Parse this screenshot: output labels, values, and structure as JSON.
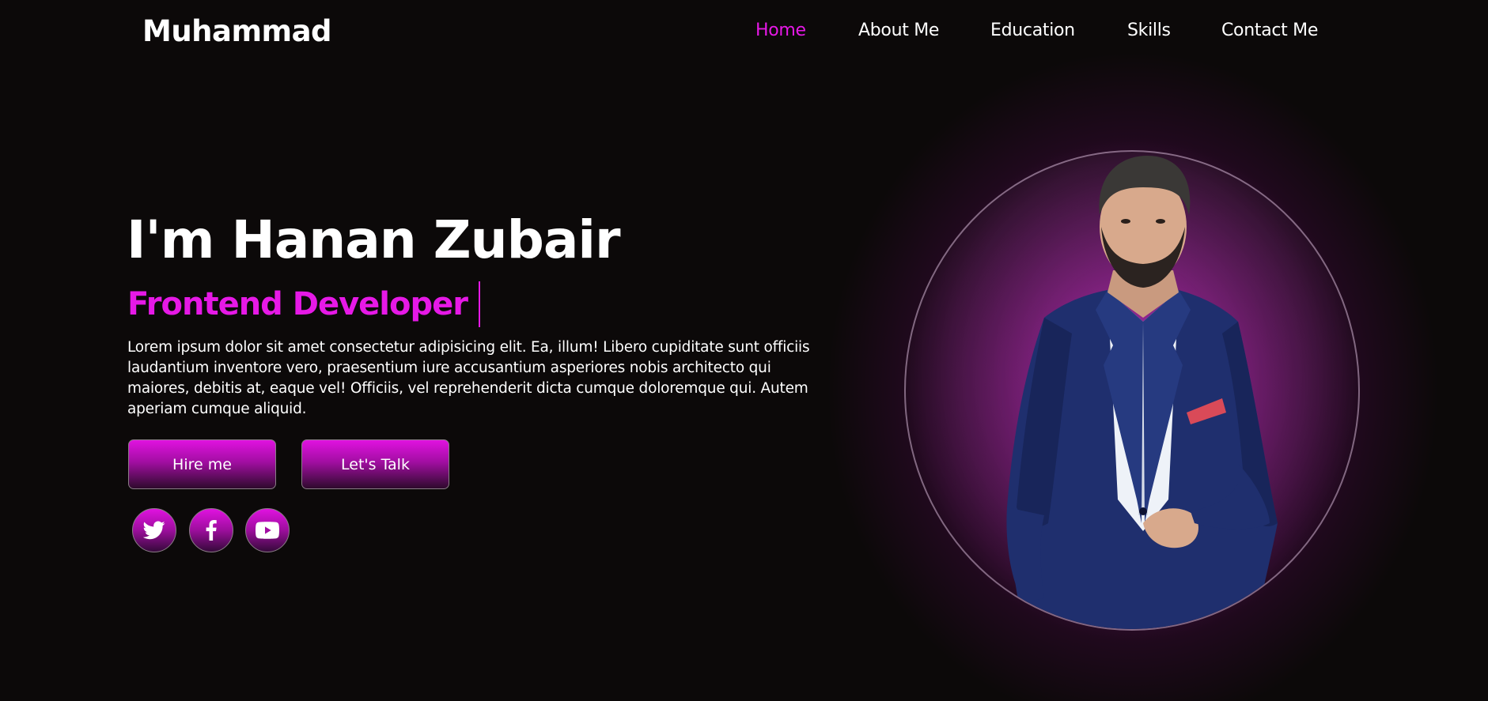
{
  "header": {
    "logo": "Muhammad",
    "nav": [
      {
        "label": "Home",
        "active": true
      },
      {
        "label": "About Me",
        "active": false
      },
      {
        "label": "Education",
        "active": false
      },
      {
        "label": "Skills",
        "active": false
      },
      {
        "label": "Contact Me",
        "active": false
      }
    ]
  },
  "hero": {
    "title": "I'm Hanan Zubair",
    "role": "Frontend Developer",
    "description": "Lorem ipsum dolor sit amet consectetur adipisicing elit. Ea, illum! Libero cupiditate sunt officiis laudantium inventore vero, praesentium iure accusantium asperiores nobis architecto qui maiores, debitis at, eaque vel! Officiis, vel reprehenderit dicta cumque doloremque qui. Autem aperiam cumque aliquid.",
    "buttons": {
      "hire": "Hire me",
      "talk": "Let's Talk"
    },
    "social": [
      {
        "icon": "twitter-icon"
      },
      {
        "icon": "facebook-icon"
      },
      {
        "icon": "youtube-icon"
      }
    ]
  },
  "portrait": {
    "subject": "man in navy suit"
  },
  "colors": {
    "accent": "#e619e6",
    "background": "#0c0909",
    "text": "#ffffff"
  }
}
